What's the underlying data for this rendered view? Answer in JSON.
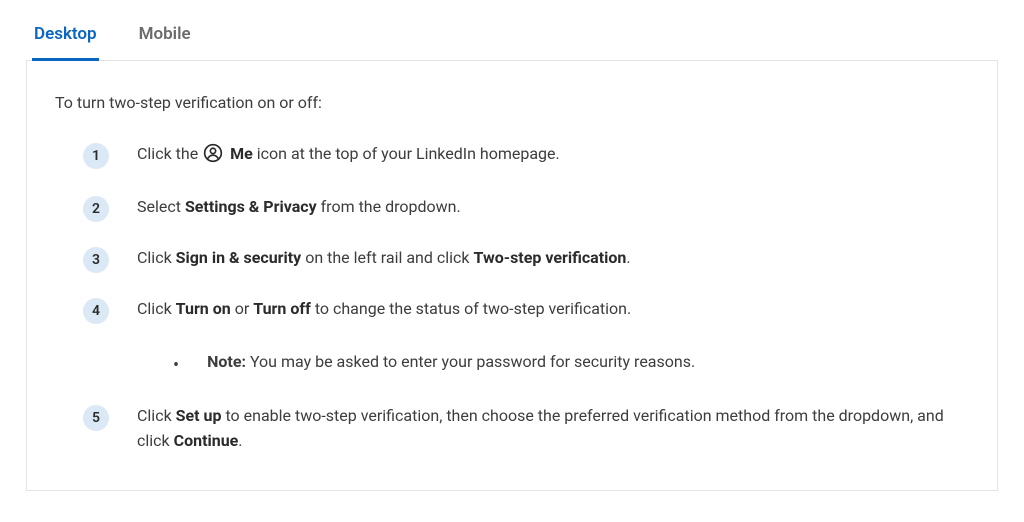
{
  "tabs": {
    "desktop": "Desktop",
    "mobile": "Mobile",
    "active": "desktop"
  },
  "intro": "To turn two-step verification on or off:",
  "steps": [
    {
      "num": "1",
      "parts": [
        {
          "t": "Click the "
        },
        {
          "icon": "me-icon"
        },
        {
          "t": " "
        },
        {
          "b": "Me"
        },
        {
          "t": " icon at the top of your LinkedIn homepage."
        }
      ]
    },
    {
      "num": "2",
      "parts": [
        {
          "t": "Select "
        },
        {
          "b": "Settings & Privacy"
        },
        {
          "t": " from the dropdown."
        }
      ]
    },
    {
      "num": "3",
      "parts": [
        {
          "t": "Click "
        },
        {
          "b": "Sign in & security"
        },
        {
          "t": " on the left rail and click "
        },
        {
          "b": "Two-step verification"
        },
        {
          "t": "."
        }
      ]
    },
    {
      "num": "4",
      "parts": [
        {
          "t": "Click "
        },
        {
          "b": "Turn on"
        },
        {
          "t": " or "
        },
        {
          "b": "Turn off"
        },
        {
          "t": " to change the status of two-step verification."
        }
      ],
      "note": {
        "label": "Note:",
        "text": " You may be asked to enter your password for security reasons."
      }
    },
    {
      "num": "5",
      "parts": [
        {
          "t": "Click "
        },
        {
          "b": "Set up"
        },
        {
          "t": " to enable two-step verification, then choose the preferred verification method from the dropdown, and click "
        },
        {
          "b": "Continue"
        },
        {
          "t": "."
        }
      ]
    }
  ]
}
